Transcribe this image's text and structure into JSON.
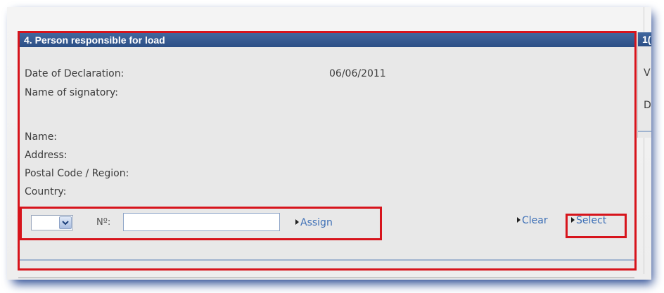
{
  "panel": {
    "title": "4. Person responsible for load",
    "fields": [
      {
        "label": "Date of Declaration:",
        "value": "06/06/2011"
      },
      {
        "label": "Name of signatory:",
        "value": ""
      },
      {
        "label": "Name:",
        "value": ""
      },
      {
        "label": "Address:",
        "value": ""
      },
      {
        "label": "Postal Code / Region:",
        "value": ""
      },
      {
        "label": "Country:",
        "value": ""
      }
    ]
  },
  "controls": {
    "select_value": "",
    "number_label": "Nº:",
    "number_value": "",
    "assign_label": "Assign",
    "clear_label": "Clear",
    "select_label": "Select"
  },
  "neighbor_panel": {
    "title": "1(",
    "line1": "V",
    "line2": "D"
  },
  "colors": {
    "header_blue": "#2c4f86",
    "link_blue": "#3d6fb6",
    "annotation_red": "#d7141c",
    "shadow_blue": "#2e4d94"
  }
}
